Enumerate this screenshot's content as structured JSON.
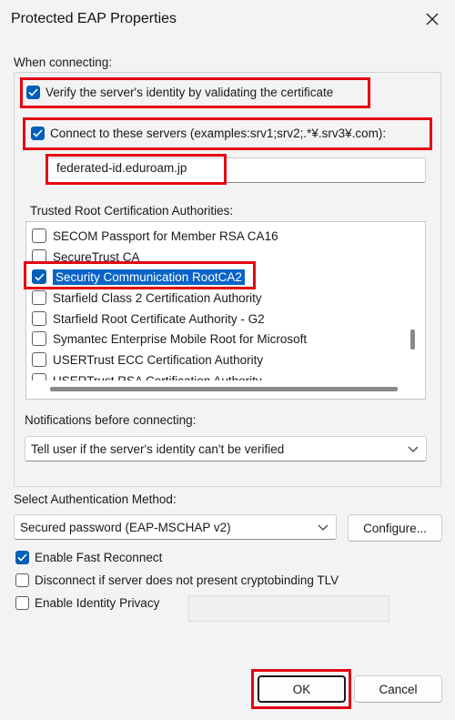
{
  "window": {
    "title": "Protected EAP Properties"
  },
  "when_connecting": {
    "label": "When connecting:",
    "verify_identity": {
      "label": "Verify the server's identity by validating the certificate",
      "checked": true
    },
    "connect_servers": {
      "label": "Connect to these servers (examples:srv1;srv2;.*¥.srv3¥.com):",
      "checked": true,
      "value": "federated-id.eduroam.jp"
    },
    "trusted_roots": {
      "label": "Trusted Root Certification Authorities:",
      "items": [
        {
          "label": "SECOM Passport for Member RSA CA16",
          "checked": false
        },
        {
          "label": "SecureTrust CA",
          "checked": false
        },
        {
          "label": "Security Communication RootCA2",
          "checked": true
        },
        {
          "label": "Starfield Class 2 Certification Authority",
          "checked": false
        },
        {
          "label": "Starfield Root Certificate Authority - G2",
          "checked": false
        },
        {
          "label": "Symantec Enterprise Mobile Root for Microsoft",
          "checked": false
        },
        {
          "label": "USERTrust ECC Certification Authority",
          "checked": false
        },
        {
          "label": "USERTrust RSA Certification Authority",
          "checked": false
        }
      ]
    },
    "notifications": {
      "label": "Notifications before connecting:",
      "value": "Tell user if the server's identity can't be verified"
    }
  },
  "auth_method": {
    "label": "Select Authentication Method:",
    "value": "Secured password (EAP-MSCHAP v2)",
    "configure_label": "Configure..."
  },
  "options": {
    "fast_reconnect": {
      "label": "Enable Fast Reconnect",
      "checked": true
    },
    "cryptobinding": {
      "label": "Disconnect if server does not present cryptobinding TLV",
      "checked": false
    },
    "identity_privacy": {
      "label": "Enable Identity Privacy",
      "checked": false
    }
  },
  "buttons": {
    "ok": "OK",
    "cancel": "Cancel"
  },
  "colors": {
    "accent": "#005fb8",
    "selection": "#0a64c8",
    "highlight_box": "#e30613"
  }
}
